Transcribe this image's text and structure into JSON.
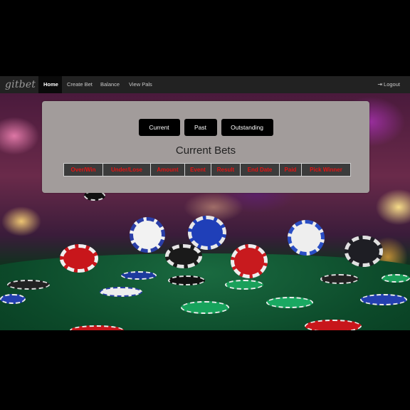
{
  "navbar": {
    "brand": "gitbet",
    "items": [
      {
        "label": "Home",
        "active": true
      },
      {
        "label": "Create Bet",
        "active": false
      },
      {
        "label": "Balance",
        "active": false
      },
      {
        "label": "View Pals",
        "active": false
      }
    ],
    "logout_label": "Logout",
    "logout_icon": "sign-out-icon"
  },
  "panel": {
    "tabs": [
      "Current",
      "Past",
      "Outstanding"
    ],
    "title": "Current Bets",
    "table_headers": [
      "Over/Win",
      "Under/Lose",
      "Amount",
      "Event",
      "Result",
      "End Date",
      "Paid",
      "Pick Winner"
    ]
  },
  "colors": {
    "navbar_bg": "#222222",
    "panel_bg": "#a29c9b",
    "header_text": "#e41414",
    "button_bg": "#000000"
  }
}
